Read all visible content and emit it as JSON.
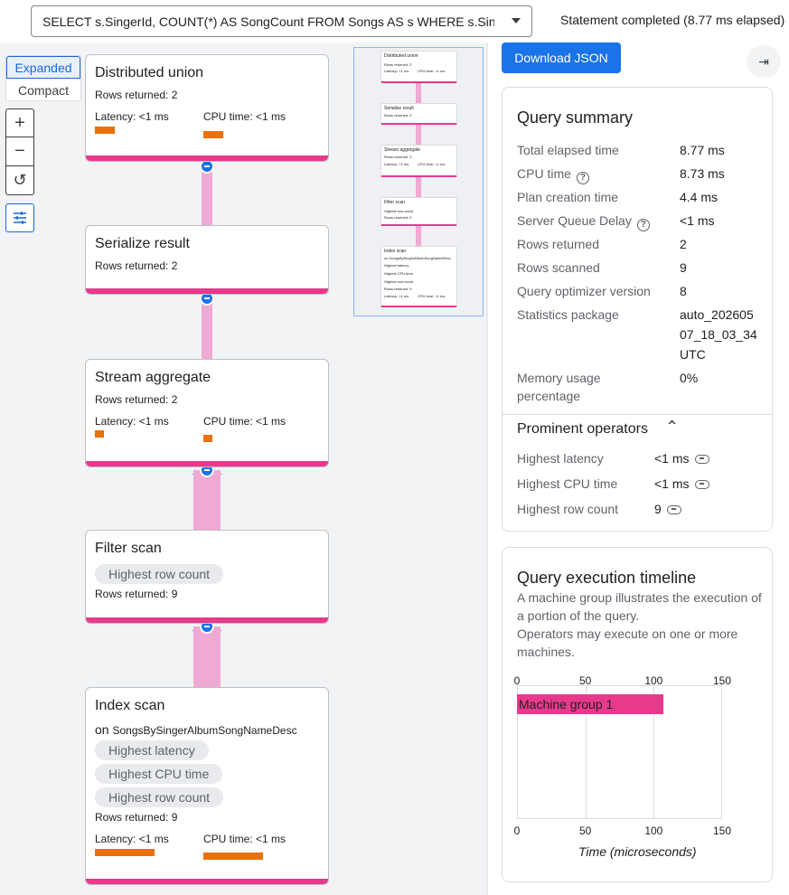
{
  "header": {
    "query": "SELECT s.SingerId, COUNT(*) AS SongCount FROM Songs AS s WHERE s.SingerId...",
    "status": "Statement completed (8.77 ms elapsed)"
  },
  "view_toggle": {
    "expanded": "Expanded",
    "compact": "Compact"
  },
  "tools": {
    "zoom_in": "+",
    "zoom_out": "−",
    "reset": "↺",
    "settings": "☰"
  },
  "nodes": [
    {
      "title": "Distributed union",
      "rows": "Rows returned: 2",
      "latency": "Latency: <1 ms",
      "cpu": "CPU time: <1 ms"
    },
    {
      "title": "Serialize result",
      "rows": "Rows returned: 2"
    },
    {
      "title": "Stream aggregate",
      "rows": "Rows returned: 2",
      "latency": "Latency: <1 ms",
      "cpu": "CPU time: <1 ms"
    },
    {
      "title": "Filter scan",
      "chips": [
        "Highest row count"
      ],
      "rows": "Rows returned: 9"
    },
    {
      "title": "Index scan",
      "on": "on",
      "index": "SongsBySingerAlbumSongNameDesc",
      "chips": [
        "Highest latency",
        "Highest CPU time",
        "Highest row count"
      ],
      "rows": "Rows returned: 9",
      "latency": "Latency: <1 ms",
      "cpu": "CPU time: <1 ms"
    }
  ],
  "minimap": {
    "nodes": [
      {
        "title": "Distributed union",
        "rows": "Rows returned: 2",
        "lat": "Latency: <1 ms",
        "cpu": "CPU time: <1 ms"
      },
      {
        "title": "Serialize result",
        "rows": "Rows returned: 2"
      },
      {
        "title": "Stream aggregate",
        "rows": "Rows returned: 2",
        "lat": "Latency: <1 ms",
        "cpu": "CPU time: <1 ms"
      },
      {
        "title": "Filter scan",
        "chip": "Highest row count",
        "rows": "Rows returned: 9"
      },
      {
        "title": "Index scan",
        "on": "on SongsBySingerAlbumSongNameDesc",
        "chips": [
          "Highest latency",
          "Highest CPU time",
          "Highest row count"
        ],
        "rows": "Rows returned: 9",
        "lat": "Latency: <1 ms",
        "cpu": "CPU time: <1 ms"
      }
    ]
  },
  "panel": {
    "download": "Download JSON",
    "collapse": "⇥",
    "summary": {
      "title": "Query summary",
      "rows": [
        {
          "k": "Total elapsed time",
          "v": "8.77 ms"
        },
        {
          "k": "CPU time",
          "v": "8.73 ms",
          "help": "?"
        },
        {
          "k": "Plan creation time",
          "v": "4.4 ms"
        },
        {
          "k": "Server Queue Delay",
          "v": "<1 ms",
          "help": "?"
        },
        {
          "k": "Rows returned",
          "v": "2"
        },
        {
          "k": "Rows scanned",
          "v": "9"
        },
        {
          "k": "Query optimizer version",
          "v": "8"
        },
        {
          "k": "Statistics package",
          "v1": "auto_202605",
          "v2": "07_18_03_34",
          "v3": "UTC"
        },
        {
          "k1": "Memory usage",
          "k2": "percentage",
          "v": "0%"
        }
      ],
      "prominent_title": "Prominent operators",
      "prominent": [
        {
          "k": "Highest latency",
          "v": "<1 ms"
        },
        {
          "k": "Highest CPU time",
          "v": "<1 ms"
        },
        {
          "k": "Highest row count",
          "v": "9"
        }
      ]
    },
    "timeline": {
      "title": "Query execution timeline",
      "desc1": "A machine group illustrates the execution of a portion of the query.",
      "desc2": "Operators may execute on one or more machines.",
      "xlabel": "Time (microseconds)"
    }
  },
  "chart_data": {
    "type": "bar",
    "orientation": "horizontal",
    "categories": [
      "Machine group 1"
    ],
    "values": [
      107
    ],
    "xlabel": "Time (microseconds)",
    "xlim": [
      0,
      150
    ],
    "ticks": [
      "0",
      "50",
      "100",
      "150"
    ],
    "colors": {
      "bar": "#e8398d"
    }
  }
}
